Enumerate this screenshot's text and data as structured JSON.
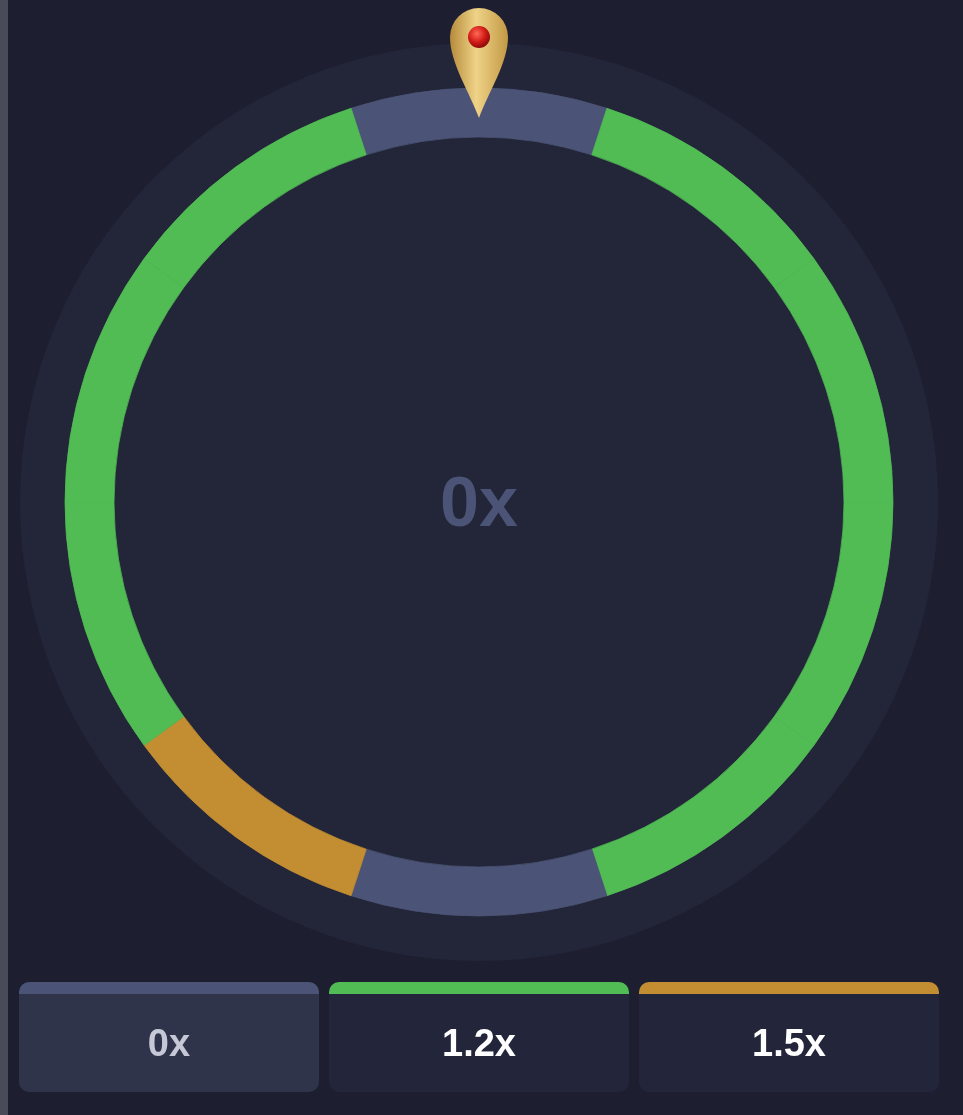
{
  "wheel": {
    "segments": [
      {
        "color": "#4b5476"
      },
      {
        "color": "#51bb54"
      },
      {
        "color": "#51bb54"
      },
      {
        "color": "#51bb54"
      },
      {
        "color": "#51bb54"
      },
      {
        "color": "#4b5476"
      },
      {
        "color": "#c38d31"
      },
      {
        "color": "#51bb54"
      },
      {
        "color": "#51bb54"
      },
      {
        "color": "#51bb54"
      }
    ],
    "result": "0x"
  },
  "legend": [
    {
      "label": "0x",
      "color": "#4b5476",
      "selected": true
    },
    {
      "label": "1.2x",
      "color": "#51bb54",
      "selected": false
    },
    {
      "label": "1.5x",
      "color": "#c38d31",
      "selected": false
    }
  ]
}
